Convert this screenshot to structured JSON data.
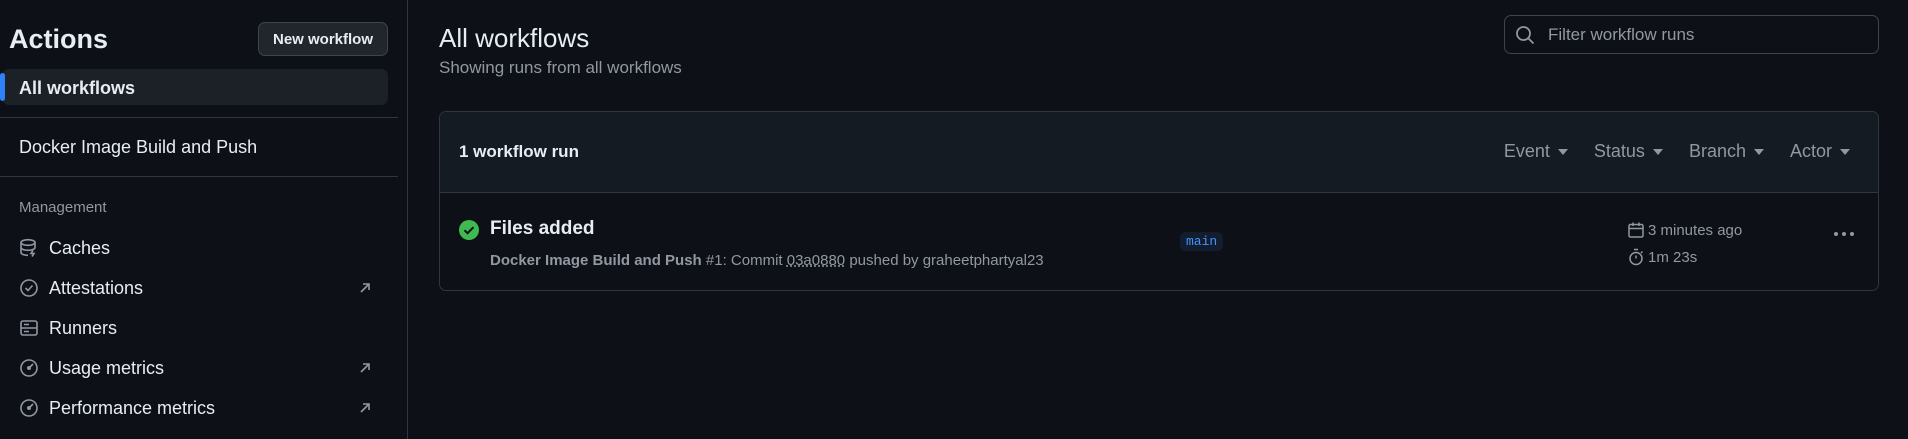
{
  "sidebar": {
    "title": "Actions",
    "new_workflow_label": "New workflow",
    "all_workflows_label": "All workflows",
    "workflows": [
      "Docker Image Build and Push"
    ],
    "section_label": "Management",
    "management": [
      {
        "label": "Caches",
        "icon": "database-icon",
        "external": false
      },
      {
        "label": "Attestations",
        "icon": "verified-icon",
        "external": true
      },
      {
        "label": "Runners",
        "icon": "server-icon",
        "external": false
      },
      {
        "label": "Usage metrics",
        "icon": "meter-icon",
        "external": true
      },
      {
        "label": "Performance metrics",
        "icon": "meter-icon",
        "external": true
      }
    ]
  },
  "main": {
    "title": "All workflows",
    "subtitle": "Showing runs from all workflows",
    "filter_placeholder": "Filter workflow runs",
    "run_count": "1 workflow run",
    "filters": [
      "Event",
      "Status",
      "Branch",
      "Actor"
    ],
    "runs": [
      {
        "title": "Files added",
        "workflow": "Docker Image Build and Push",
        "number": "#1",
        "meta_mid": ": Commit ",
        "sha": "03a0880",
        "pushed_by": " pushed by graheetphartyal23",
        "branch": "main",
        "when": "3 minutes ago",
        "duration": "1m 23s",
        "status": "success"
      }
    ]
  },
  "colors": {
    "background": "#0d1117",
    "accent": "#2f81f7",
    "success": "#3fb950",
    "muted": "#9198a1",
    "branch_text": "#4493f8"
  }
}
